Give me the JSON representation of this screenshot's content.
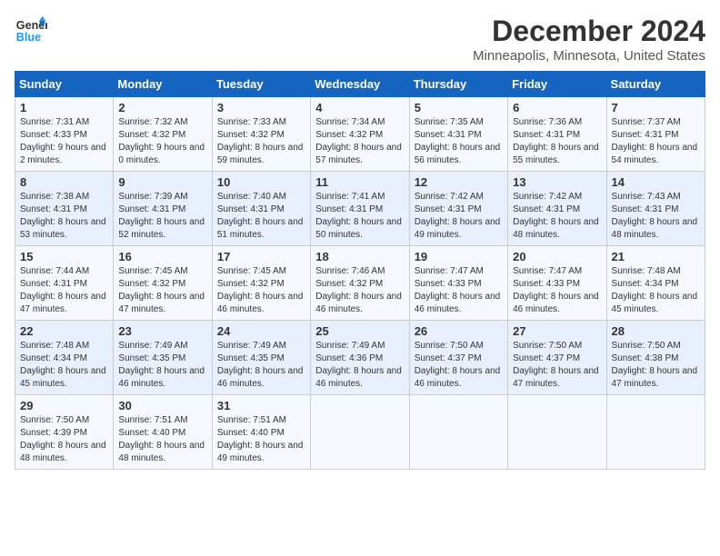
{
  "logo": {
    "line1": "General",
    "line2": "Blue"
  },
  "title": "December 2024",
  "location": "Minneapolis, Minnesota, United States",
  "days_of_week": [
    "Sunday",
    "Monday",
    "Tuesday",
    "Wednesday",
    "Thursday",
    "Friday",
    "Saturday"
  ],
  "weeks": [
    [
      {
        "day": "1",
        "sunrise": "7:31 AM",
        "sunset": "4:33 PM",
        "daylight": "9 hours and 2 minutes."
      },
      {
        "day": "2",
        "sunrise": "7:32 AM",
        "sunset": "4:32 PM",
        "daylight": "9 hours and 0 minutes."
      },
      {
        "day": "3",
        "sunrise": "7:33 AM",
        "sunset": "4:32 PM",
        "daylight": "8 hours and 59 minutes."
      },
      {
        "day": "4",
        "sunrise": "7:34 AM",
        "sunset": "4:32 PM",
        "daylight": "8 hours and 57 minutes."
      },
      {
        "day": "5",
        "sunrise": "7:35 AM",
        "sunset": "4:31 PM",
        "daylight": "8 hours and 56 minutes."
      },
      {
        "day": "6",
        "sunrise": "7:36 AM",
        "sunset": "4:31 PM",
        "daylight": "8 hours and 55 minutes."
      },
      {
        "day": "7",
        "sunrise": "7:37 AM",
        "sunset": "4:31 PM",
        "daylight": "8 hours and 54 minutes."
      }
    ],
    [
      {
        "day": "8",
        "sunrise": "7:38 AM",
        "sunset": "4:31 PM",
        "daylight": "8 hours and 53 minutes."
      },
      {
        "day": "9",
        "sunrise": "7:39 AM",
        "sunset": "4:31 PM",
        "daylight": "8 hours and 52 minutes."
      },
      {
        "day": "10",
        "sunrise": "7:40 AM",
        "sunset": "4:31 PM",
        "daylight": "8 hours and 51 minutes."
      },
      {
        "day": "11",
        "sunrise": "7:41 AM",
        "sunset": "4:31 PM",
        "daylight": "8 hours and 50 minutes."
      },
      {
        "day": "12",
        "sunrise": "7:42 AM",
        "sunset": "4:31 PM",
        "daylight": "8 hours and 49 minutes."
      },
      {
        "day": "13",
        "sunrise": "7:42 AM",
        "sunset": "4:31 PM",
        "daylight": "8 hours and 48 minutes."
      },
      {
        "day": "14",
        "sunrise": "7:43 AM",
        "sunset": "4:31 PM",
        "daylight": "8 hours and 48 minutes."
      }
    ],
    [
      {
        "day": "15",
        "sunrise": "7:44 AM",
        "sunset": "4:31 PM",
        "daylight": "8 hours and 47 minutes."
      },
      {
        "day": "16",
        "sunrise": "7:45 AM",
        "sunset": "4:32 PM",
        "daylight": "8 hours and 47 minutes."
      },
      {
        "day": "17",
        "sunrise": "7:45 AM",
        "sunset": "4:32 PM",
        "daylight": "8 hours and 46 minutes."
      },
      {
        "day": "18",
        "sunrise": "7:46 AM",
        "sunset": "4:32 PM",
        "daylight": "8 hours and 46 minutes."
      },
      {
        "day": "19",
        "sunrise": "7:47 AM",
        "sunset": "4:33 PM",
        "daylight": "8 hours and 46 minutes."
      },
      {
        "day": "20",
        "sunrise": "7:47 AM",
        "sunset": "4:33 PM",
        "daylight": "8 hours and 46 minutes."
      },
      {
        "day": "21",
        "sunrise": "7:48 AM",
        "sunset": "4:34 PM",
        "daylight": "8 hours and 45 minutes."
      }
    ],
    [
      {
        "day": "22",
        "sunrise": "7:48 AM",
        "sunset": "4:34 PM",
        "daylight": "8 hours and 45 minutes."
      },
      {
        "day": "23",
        "sunrise": "7:49 AM",
        "sunset": "4:35 PM",
        "daylight": "8 hours and 46 minutes."
      },
      {
        "day": "24",
        "sunrise": "7:49 AM",
        "sunset": "4:35 PM",
        "daylight": "8 hours and 46 minutes."
      },
      {
        "day": "25",
        "sunrise": "7:49 AM",
        "sunset": "4:36 PM",
        "daylight": "8 hours and 46 minutes."
      },
      {
        "day": "26",
        "sunrise": "7:50 AM",
        "sunset": "4:37 PM",
        "daylight": "8 hours and 46 minutes."
      },
      {
        "day": "27",
        "sunrise": "7:50 AM",
        "sunset": "4:37 PM",
        "daylight": "8 hours and 47 minutes."
      },
      {
        "day": "28",
        "sunrise": "7:50 AM",
        "sunset": "4:38 PM",
        "daylight": "8 hours and 47 minutes."
      }
    ],
    [
      {
        "day": "29",
        "sunrise": "7:50 AM",
        "sunset": "4:39 PM",
        "daylight": "8 hours and 48 minutes."
      },
      {
        "day": "30",
        "sunrise": "7:51 AM",
        "sunset": "4:40 PM",
        "daylight": "8 hours and 48 minutes."
      },
      {
        "day": "31",
        "sunrise": "7:51 AM",
        "sunset": "4:40 PM",
        "daylight": "8 hours and 49 minutes."
      },
      null,
      null,
      null,
      null
    ]
  ],
  "labels": {
    "sunrise": "Sunrise:",
    "sunset": "Sunset:",
    "daylight": "Daylight:"
  }
}
